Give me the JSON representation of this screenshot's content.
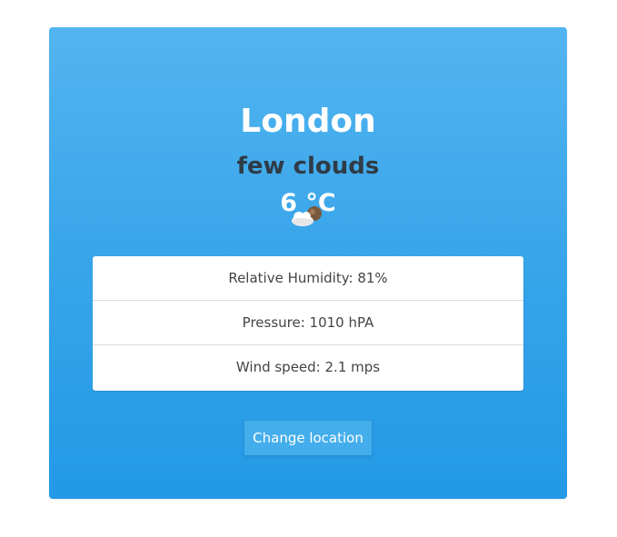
{
  "location": {
    "city": "London"
  },
  "weather": {
    "description": "few clouds",
    "temperature": "6 °C",
    "icon": "partly-cloudy-night-icon"
  },
  "stats": [
    {
      "label": "Relative Humidity: 81%"
    },
    {
      "label": "Pressure: 1010 hPA"
    },
    {
      "label": "Wind speed: 2.1 mps"
    }
  ],
  "actions": {
    "change_location_label": "Change location"
  },
  "colors": {
    "card_top": "#53b5ef",
    "card_bottom": "#2399e6",
    "description_text": "#2f3b47",
    "button_bg": "#44aeec"
  }
}
